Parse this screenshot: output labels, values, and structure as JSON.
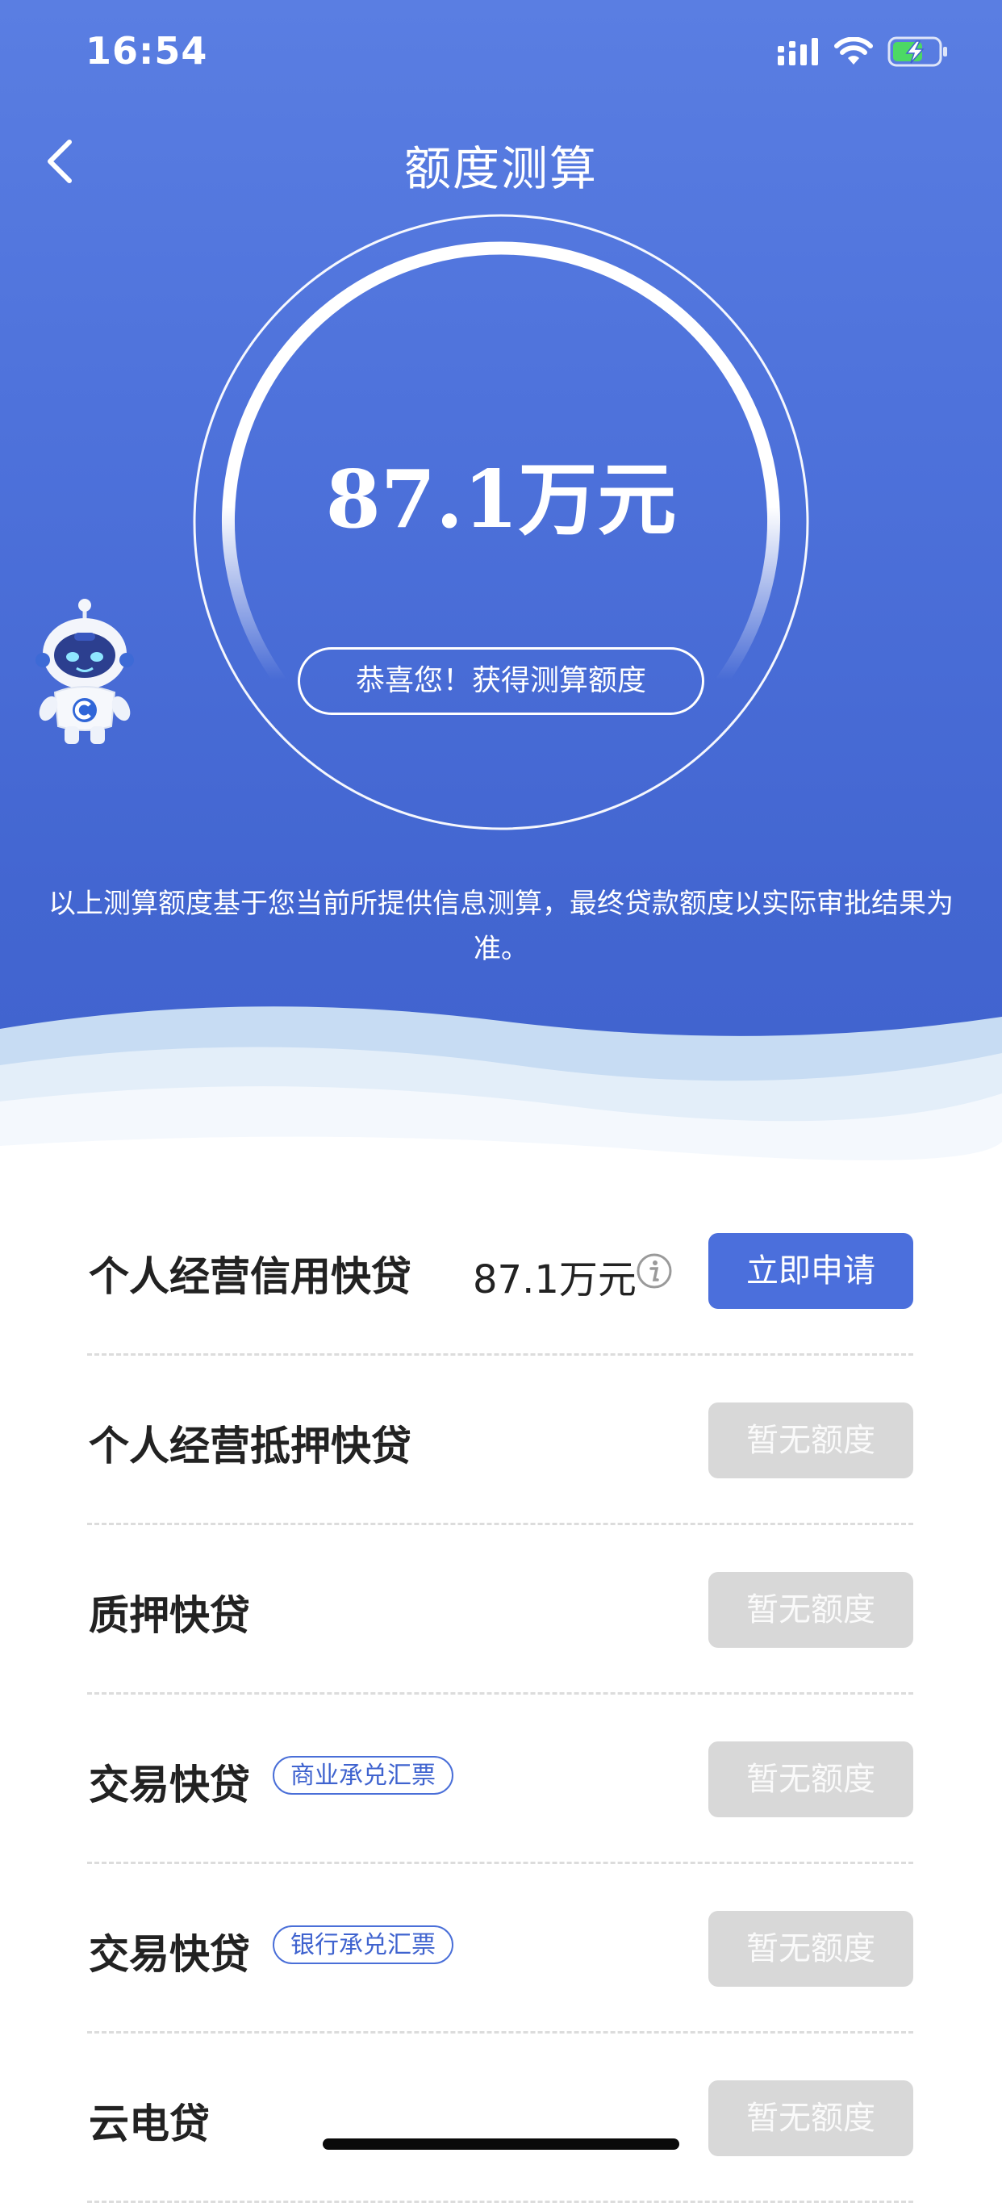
{
  "status_bar": {
    "time": "16:54",
    "icons": [
      "signal-icon",
      "wifi-icon",
      "battery-charging-icon"
    ]
  },
  "header": {
    "title": "额度测算"
  },
  "result": {
    "amount": "87.1万元",
    "congrats": "恭喜您！获得测算额度",
    "disclaimer": "以上测算额度基于您当前所提供信息测算，最终贷款额度以实际审批结果为准。"
  },
  "colors": {
    "primary": "#4b6fdc",
    "hero_top": "#5a7ee2",
    "hero_bottom": "#3f62cd",
    "disabled": "#d8d8d8"
  },
  "loans": [
    {
      "name": "个人经营信用快贷",
      "tag": "",
      "amount": "87.1万元",
      "button": "立即申请",
      "available": true
    },
    {
      "name": "个人经营抵押快贷",
      "tag": "",
      "amount": "",
      "button": "暂无额度",
      "available": false
    },
    {
      "name": "质押快贷",
      "tag": "",
      "amount": "",
      "button": "暂无额度",
      "available": false
    },
    {
      "name": "交易快贷",
      "tag": "商业承兑汇票",
      "amount": "",
      "button": "暂无额度",
      "available": false
    },
    {
      "name": "交易快贷",
      "tag": "银行承兑汇票",
      "amount": "",
      "button": "暂无额度",
      "available": false
    },
    {
      "name": "云电贷",
      "tag": "",
      "amount": "",
      "button": "暂无额度",
      "available": false
    }
  ]
}
